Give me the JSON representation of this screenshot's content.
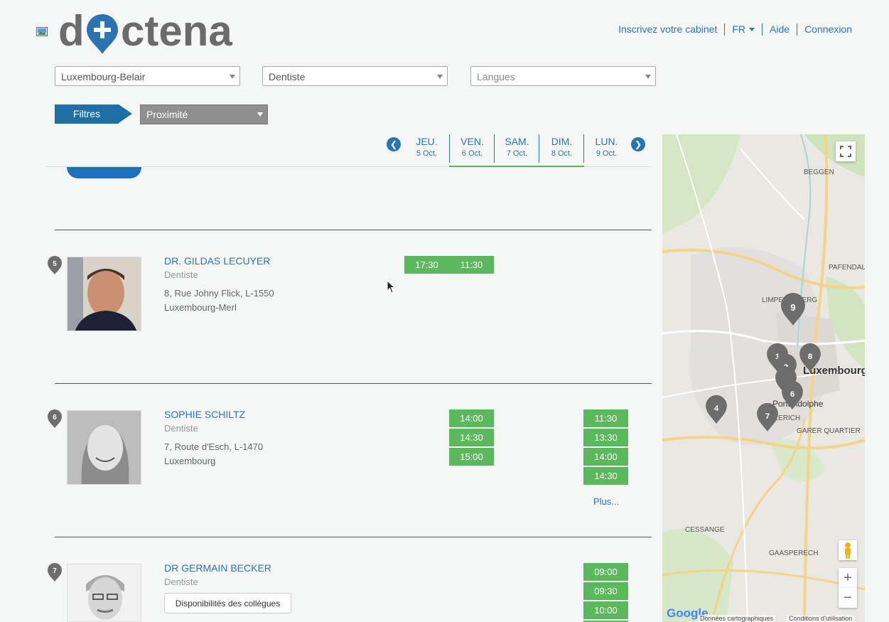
{
  "header": {
    "logo_text": "doctena",
    "nav": [
      {
        "label": "Inscrivez votre cabinet"
      },
      {
        "label": "FR"
      },
      {
        "label": "Aide"
      },
      {
        "label": "Connexion"
      }
    ]
  },
  "search": {
    "location": "Luxembourg-Belair",
    "specialty": "Dentiste",
    "language_placeholder": "Langues"
  },
  "filters": {
    "button_label": "Filtres",
    "sort_value": "Proximité"
  },
  "days": [
    {
      "name": "JEU.",
      "date": "5 Oct."
    },
    {
      "name": "VEN.",
      "date": "6 Oct."
    },
    {
      "name": "SAM.",
      "date": "7 Oct."
    },
    {
      "name": "DIM.",
      "date": "8 Oct."
    },
    {
      "name": "LUN.",
      "date": "9 Oct."
    }
  ],
  "doctors": [
    {
      "number": "5",
      "name": "DR. GILDAS LECUYER",
      "specialty": "Dentiste",
      "address_line1": "8, Rue Johny Flick, L-1550",
      "address_line2": "Luxembourg-Merl",
      "slots": {
        "jeu": [
          "17:30"
        ],
        "ven": [
          "11:30"
        ]
      }
    },
    {
      "number": "6",
      "name": "SOPHIE SCHILTZ",
      "specialty": "Dentiste",
      "address_line1": "7, Route d'Esch, L-1470",
      "address_line2": "Luxembourg",
      "slots": {
        "ven": [
          "14:00",
          "14:30",
          "15:00"
        ],
        "lun": [
          "11:30",
          "13:30",
          "14:00",
          "14:30"
        ]
      },
      "more_label": "Plus..."
    },
    {
      "number": "7",
      "name": "DR GERMAIN BECKER",
      "specialty": "Dentiste",
      "colleagues_label": "Disponibilités des collègues",
      "slots": {
        "lun": [
          "09:00",
          "09:30",
          "10:00"
        ]
      }
    }
  ],
  "map": {
    "markers": [
      "1",
      "2",
      "4",
      "6",
      "7",
      "8",
      "9"
    ],
    "places": [
      "BEGGEN",
      "LIMPERTSBERG",
      "PAFENDAL",
      "Luxembourg",
      "Pont Adolphe",
      "HOLLERICH",
      "GARER QUARTIER",
      "CESSANGE",
      "GAASPERECH"
    ],
    "place_labels": {
      "beggen": "BEGGEN",
      "limpertsberg": "LIMPERTSBERG",
      "pafendal": "PAFENDAL",
      "luxembourg": "Luxembourg",
      "pont_adolphe": "Pont Adolphe",
      "hollerich": "HOLLERICH",
      "garer": "GARER QUARTIER",
      "cessange": "CESSANGE",
      "gaasperech": "GAASPERECH"
    },
    "zoom_in": "+",
    "zoom_out": "−",
    "brand": "Google",
    "attribution": "Données cartographiques",
    "terms": "Conditions d'utilisation"
  },
  "colors": {
    "primary": "#2a74b1",
    "slot_green": "#5cb85c",
    "filters_blue": "#1d6fa6"
  }
}
